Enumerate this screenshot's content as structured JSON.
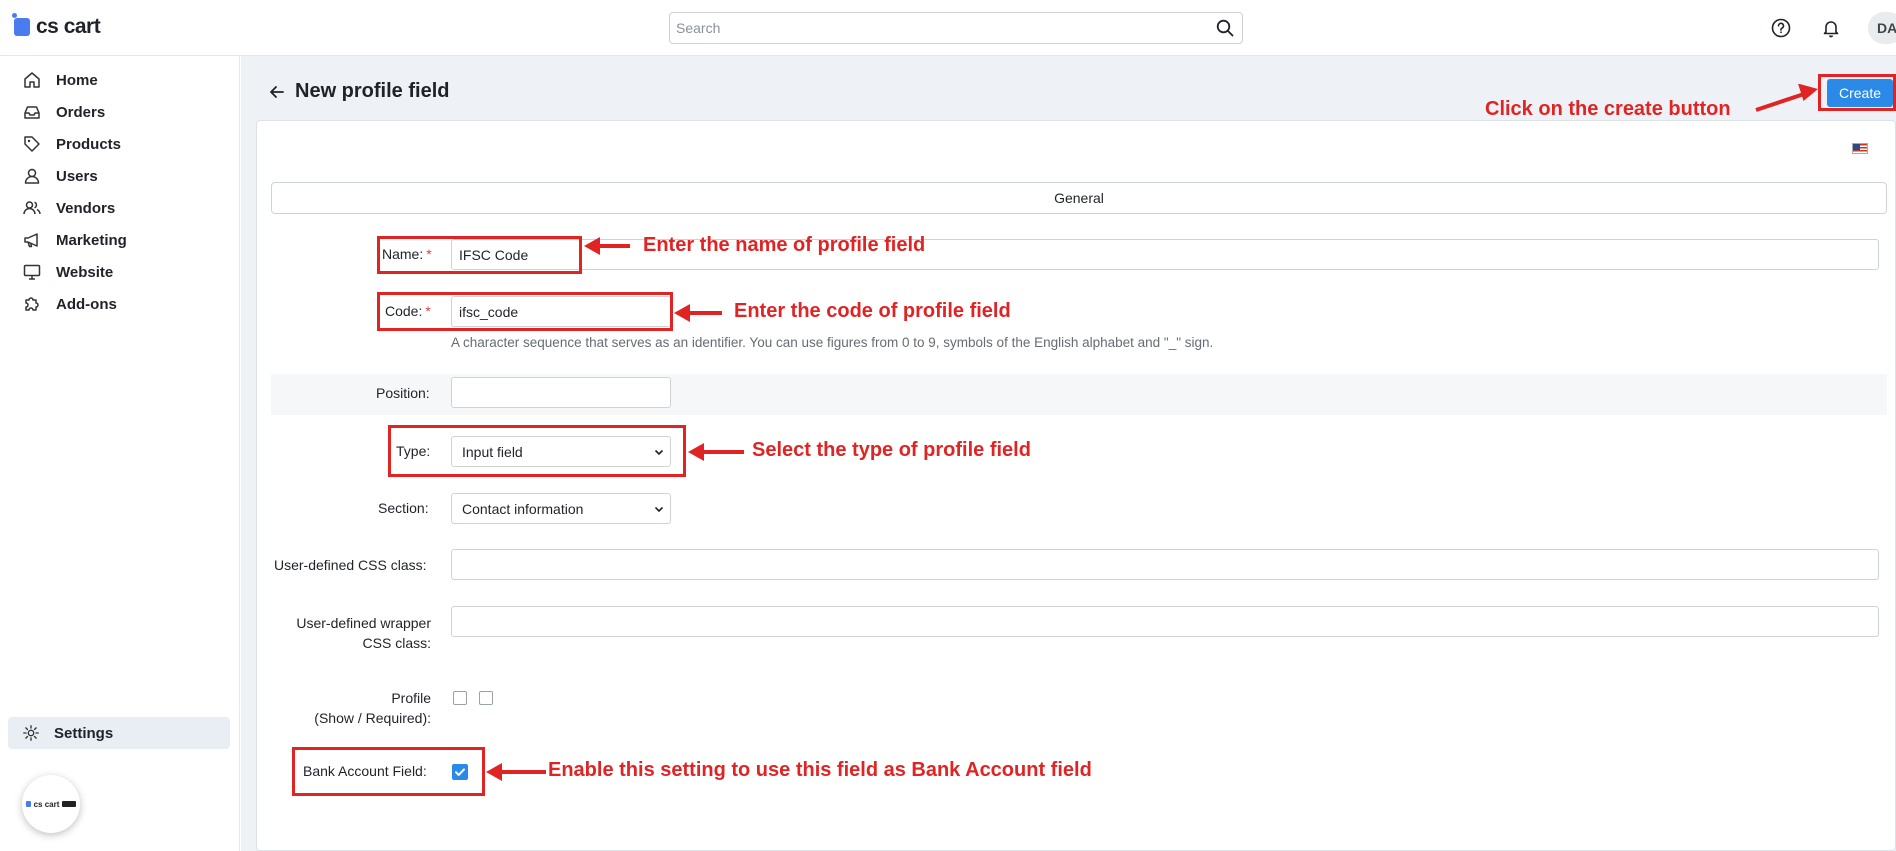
{
  "app": {
    "logo_text": "cs cart",
    "bubble_text": "cs cart"
  },
  "search": {
    "placeholder": "Search",
    "value": ""
  },
  "header": {
    "avatar_initials": "DA",
    "help_icon": "question-circle-icon",
    "notifications_icon": "bell-icon"
  },
  "sidebar": {
    "items": [
      {
        "label": "Home",
        "icon": "home-icon"
      },
      {
        "label": "Orders",
        "icon": "inbox-icon"
      },
      {
        "label": "Products",
        "icon": "tag-icon"
      },
      {
        "label": "Users",
        "icon": "user-icon"
      },
      {
        "label": "Vendors",
        "icon": "users-icon"
      },
      {
        "label": "Marketing",
        "icon": "megaphone-icon"
      },
      {
        "label": "Website",
        "icon": "monitor-icon"
      },
      {
        "label": "Add-ons",
        "icon": "puzzle-icon"
      }
    ],
    "settings": {
      "label": "Settings",
      "icon": "gear-icon"
    }
  },
  "page": {
    "title": "New profile field",
    "create_label": "Create",
    "tab_general": "General"
  },
  "form": {
    "name": {
      "label": "Name:",
      "value": "IFSC Code"
    },
    "code": {
      "label": "Code:",
      "value": "ifsc_code",
      "hint": "A character sequence that serves as an identifier. You can use figures from 0 to 9, symbols of the English alphabet and \"_\" sign."
    },
    "position": {
      "label": "Position:",
      "value": ""
    },
    "type": {
      "label": "Type:",
      "value": "Input field"
    },
    "section": {
      "label": "Section:",
      "value": "Contact information"
    },
    "css_class": {
      "label": "User-defined CSS class:",
      "value": ""
    },
    "wrapper_css": {
      "label_line1": "User-defined wrapper",
      "label_line2": "CSS class:",
      "value": ""
    },
    "profile": {
      "label_line1": "Profile",
      "label_line2": "(Show / Required):",
      "show": false,
      "required": false
    },
    "bank_account": {
      "label": "Bank Account Field:",
      "checked": true
    },
    "required_mark": "*"
  },
  "annotations": {
    "name": "Enter the name of profile field",
    "code": "Enter the code of profile field",
    "type": "Select the type of profile field",
    "create": "Click on the create button",
    "bank": "Enable this setting to use this field as Bank Account field",
    "color": "#e02424"
  },
  "colors": {
    "accent": "#2b8ae8",
    "page_bg": "#eef2f6",
    "annotation": "#e02424"
  }
}
